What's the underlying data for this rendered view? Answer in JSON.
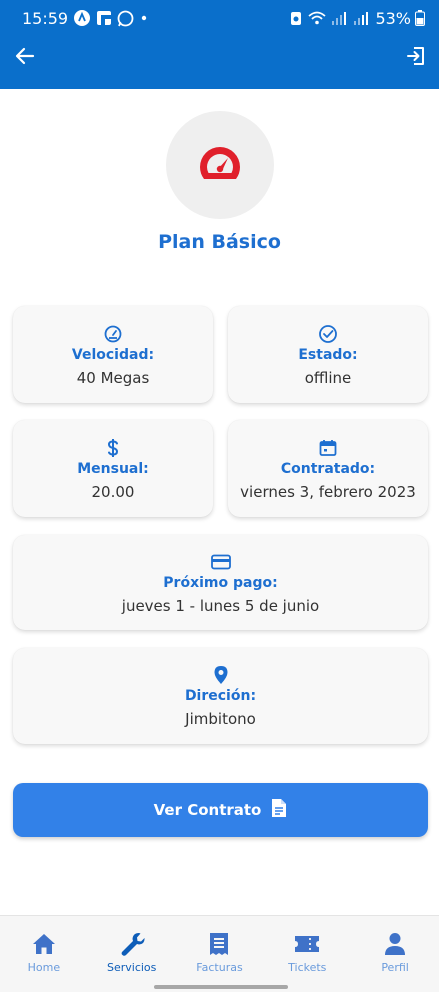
{
  "status_bar": {
    "time": "15:59",
    "battery": "53%"
  },
  "plan": {
    "title": "Plan Básico"
  },
  "cards": {
    "velocidad": {
      "label": "Velocidad:",
      "value": "40 Megas"
    },
    "estado": {
      "label": "Estado:",
      "value": "offline"
    },
    "mensual": {
      "label": "Mensual:",
      "value": "20.00"
    },
    "contratado": {
      "label": "Contratado:",
      "value": "viernes 3, febrero 2023"
    },
    "proximo_pago": {
      "label": "Próximo pago:",
      "value": "jueves 1 - lunes 5 de junio"
    },
    "direccion": {
      "label": "Direción:",
      "value": "Jimbitono"
    }
  },
  "contract_button": {
    "label": "Ver Contrato"
  },
  "bottom_nav": [
    {
      "label": "Home",
      "icon": "home-icon",
      "active": false
    },
    {
      "label": "Servicios",
      "icon": "wrench-icon",
      "active": true
    },
    {
      "label": "Facturas",
      "icon": "receipt-icon",
      "active": false
    },
    {
      "label": "Tickets",
      "icon": "ticket-icon",
      "active": false
    },
    {
      "label": "Perfil",
      "icon": "user-icon",
      "active": false
    }
  ],
  "colors": {
    "header": "#0a6fcb",
    "accent": "#1e6fd0",
    "button": "#3281e8",
    "gauge": "#e0202b",
    "nav_inactive": "#6a9bdc",
    "nav_active": "#0e5db8"
  }
}
